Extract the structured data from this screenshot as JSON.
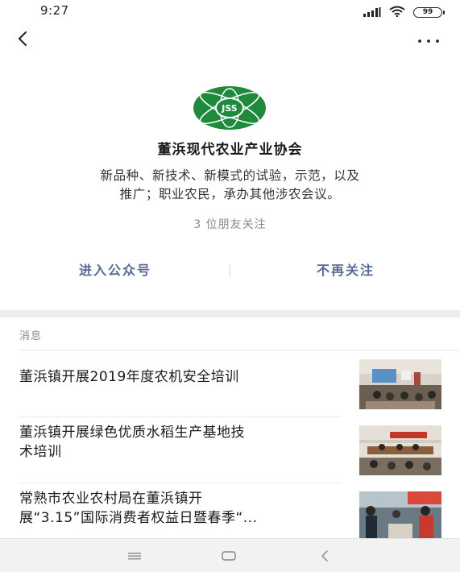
{
  "status_bar": {
    "time": "9:27",
    "battery": "99",
    "icons": [
      "signal-icon",
      "wifi-icon",
      "battery-icon"
    ]
  },
  "nav": {
    "back_icon": "back-chevron-icon",
    "more_icon": "more-dots-icon"
  },
  "profile": {
    "logo_text": "JSS",
    "name": "董浜现代农业产业协会",
    "description_line1": "新品种、新技术、新模式的试验，示范，以及",
    "description_line2": "推广；职业农民，承办其他涉农会议。",
    "friends_follow": "3 位朋友关注"
  },
  "actions": {
    "enter_label": "进入公众号",
    "unfollow_label": "不再关注",
    "accent_color": "#576b95"
  },
  "messages": {
    "section_label": "消息",
    "articles": [
      {
        "title": "董浜镇开展2019年度农机安全培训"
      },
      {
        "title_line1": "董浜镇开展绿色优质水稻生产基地技",
        "title_line2": "术培训"
      },
      {
        "title_line1": "常熟市农业农村局在董浜镇开",
        "title_line2": "展“3.15”国际消费者权益日暨春季“..."
      }
    ]
  },
  "system_nav": {
    "icons": [
      "menu-icon",
      "home-icon",
      "back-icon"
    ]
  }
}
